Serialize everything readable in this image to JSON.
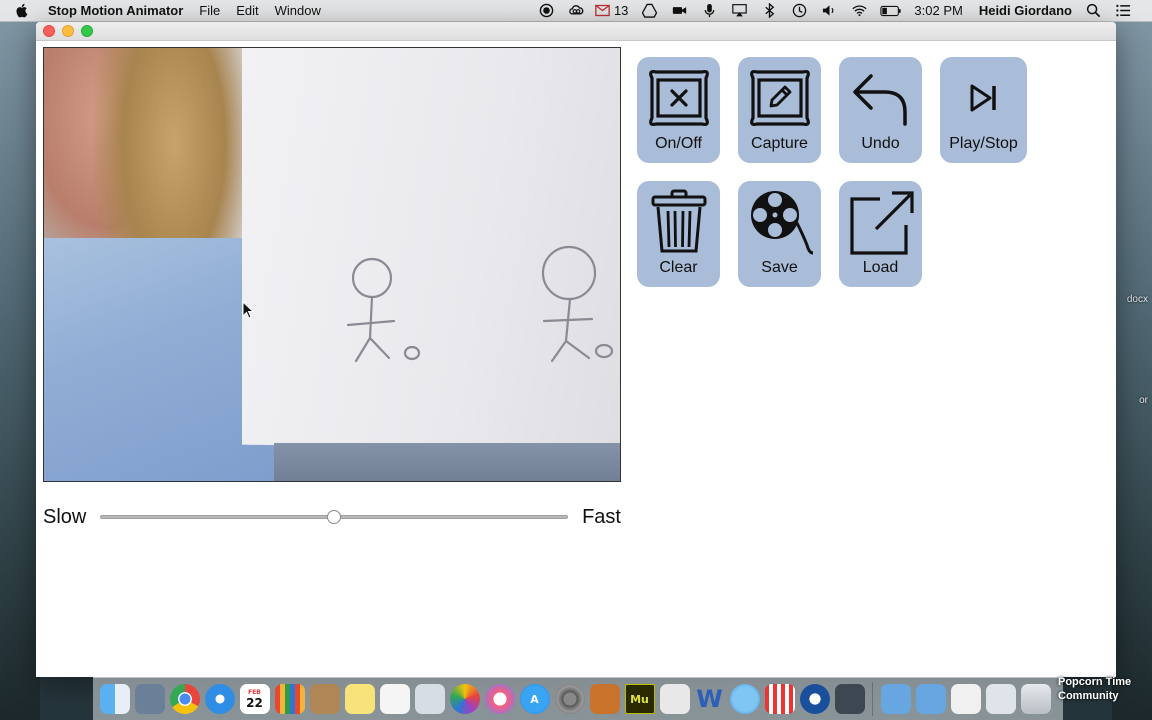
{
  "menubar": {
    "app_name": "Stop Motion Animator",
    "menus": [
      "File",
      "Edit",
      "Window"
    ],
    "mail_count": "13",
    "clock": "3:02 PM",
    "user": "Heidi Giordano"
  },
  "desktop": {
    "label_1": "docx",
    "label_2": "or"
  },
  "speed": {
    "slow_label": "Slow",
    "fast_label": "Fast",
    "value_fraction": 0.5
  },
  "tools": {
    "onoff": "On/Off",
    "capture": "Capture",
    "undo": "Undo",
    "playstop": "Play/Stop",
    "clear": "Clear",
    "save": "Save",
    "load": "Load"
  },
  "colors": {
    "button_fill": "#a9bcd8",
    "window_bg": "#ffffff"
  },
  "dock": {
    "calendar_month": "FEB",
    "calendar_day": "22",
    "muse_label": "Mu",
    "word_label": "W",
    "caption": "Popcorn Time Community"
  }
}
